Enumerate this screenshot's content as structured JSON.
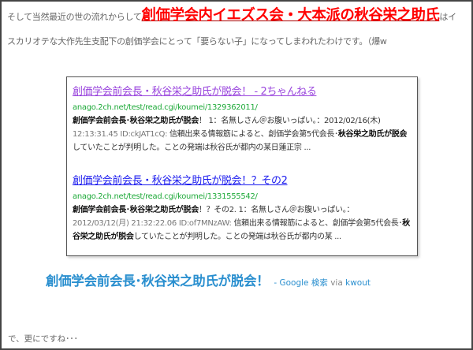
{
  "intro": {
    "before": "そして当然最近の世の流れからして",
    "highlight": "創価学会内イエズス会・大本派の秋谷栄之助氏",
    "after": "はイスカリオテな大作先生支配下の創価学会にとって「要らない子」になってしまわれたわけです。（爆w"
  },
  "results": [
    {
      "title": "創価学会前会長・秋谷栄之助氏が脱会！ - 2ちゃんねる",
      "url": "anago.2ch.net/test/read.cgi/koumei/1329362011/",
      "s1_bold": "創価学会前会長･秋谷栄之助氏が脱会",
      "s1": "！ 1：名無しさん＠お腹いっぱい。：2012/02/16(木)",
      "ts": "12:13:31.45 ID:ckJAT1cQ:",
      "s2": " 信頼出来る情報筋によると、創価学会第5代会長･",
      "s2_bold": "秋谷栄之助氏が脱会",
      "s3": "していたことが判明した。ことの発端は秋谷氏が都内の某日蓮正宗 ..."
    },
    {
      "title": "創価学会前会長・秋谷栄之助氏が脱会！？その2",
      "url": "anago.2ch.net/test/read.cgi/koumei/1331555542/",
      "s1_bold": "創価学会前会長･秋谷栄之助氏が脱会",
      "s1": "！？その2. 1：名無しさん＠お腹いっぱい。：",
      "ts": "2012/03/12(月) 21:32:22.06 ID:of7MNzAW:",
      "s2": " 信頼出来る情報筋によると、創価学会第5代会長･",
      "s2_bold": "秋谷栄之助氏が脱会",
      "s3": "していたことが判明した。ことの発端は秋谷氏が都内の某 ..."
    }
  ],
  "caption": {
    "title": "創価学会前会長･秋谷栄之助氏が脱会！",
    "source": "- Google 検索",
    "via": "via",
    "kwout": "kwout"
  },
  "outro": "で、更にですね･･･",
  "colors": {
    "highlight": "#ff0000",
    "visited": "#9944dd",
    "link": "#1a1aee",
    "url": "#1faa3a",
    "caption": "#2a8fcf"
  }
}
